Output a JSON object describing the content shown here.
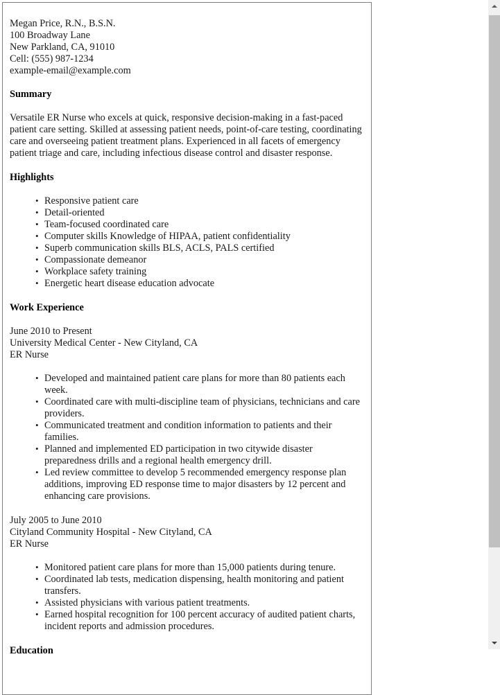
{
  "document": {
    "type": "resume",
    "contact": {
      "name_line": "Megan Price, R.N., B.S.N.",
      "street": "100 Broadway Lane",
      "city_state_zip": "New Parkland, CA, 91010",
      "phone": "Cell: (555) 987-1234",
      "email": "example-email@example.com"
    },
    "sections": {
      "summary": {
        "heading": "Summary",
        "body": "Versatile ER Nurse who excels at quick, responsive decision-making in a fast-paced patient care setting. Skilled at assessing patient needs, point-of-care testing, coordinating care and overseeing patient treatment plans. Experienced in all facets of emergency patient triage and care, including infectious disease control and disaster response."
      },
      "highlights": {
        "heading": "Highlights",
        "items": [
          "Responsive patient care",
          "Detail-oriented",
          "Team-focused coordinated care",
          "Computer skills Knowledge of HIPAA, patient confidentiality",
          "Superb communication skills BLS, ACLS, PALS certified",
          "Compassionate demeanor",
          "Workplace safety training",
          "Energetic heart disease education advocate"
        ]
      },
      "work_experience": {
        "heading": "Work Experience",
        "jobs": [
          {
            "dates": "June 2010 to Present",
            "employer": "University Medical Center - New Cityland, CA",
            "title": "ER Nurse",
            "bullets": [
              "Developed and maintained patient care plans for more than 80 patients each week.",
              "Coordinated care with multi-discipline team of physicians, technicians and care providers.",
              "Communicated treatment and condition information to patients and their families.",
              "Planned and implemented ED participation in two citywide disaster preparedness drills and a regional health emergency drill.",
              "Led review committee to develop 5 recommended emergency response plan additions, improving ED response time to major disasters by 12 percent and enhancing care provisions."
            ]
          },
          {
            "dates": "July 2005 to June 2010",
            "employer": "Cityland Community Hospital - New Cityland, CA",
            "title": "ER Nurse",
            "bullets": [
              "Monitored patient care plans for more than 15,000 patients during tenure.",
              "Coordinated lab tests, medication dispensing, health monitoring and patient transfers.",
              "Assisted physicians with various patient treatments.",
              "Earned hospital recognition for 100 percent accuracy of audited patient charts, incident reports and admission procedures."
            ]
          }
        ]
      },
      "education": {
        "heading": "Education"
      }
    }
  },
  "scrollbar": {
    "up_icon": "triangle-up-icon",
    "down_icon": "triangle-down-icon"
  },
  "colors": {
    "page_border": "#808080",
    "text": "#1a1a1a",
    "scrollbar_track": "#f0f0f0",
    "scrollbar_thumb": "#c0c0c0"
  }
}
